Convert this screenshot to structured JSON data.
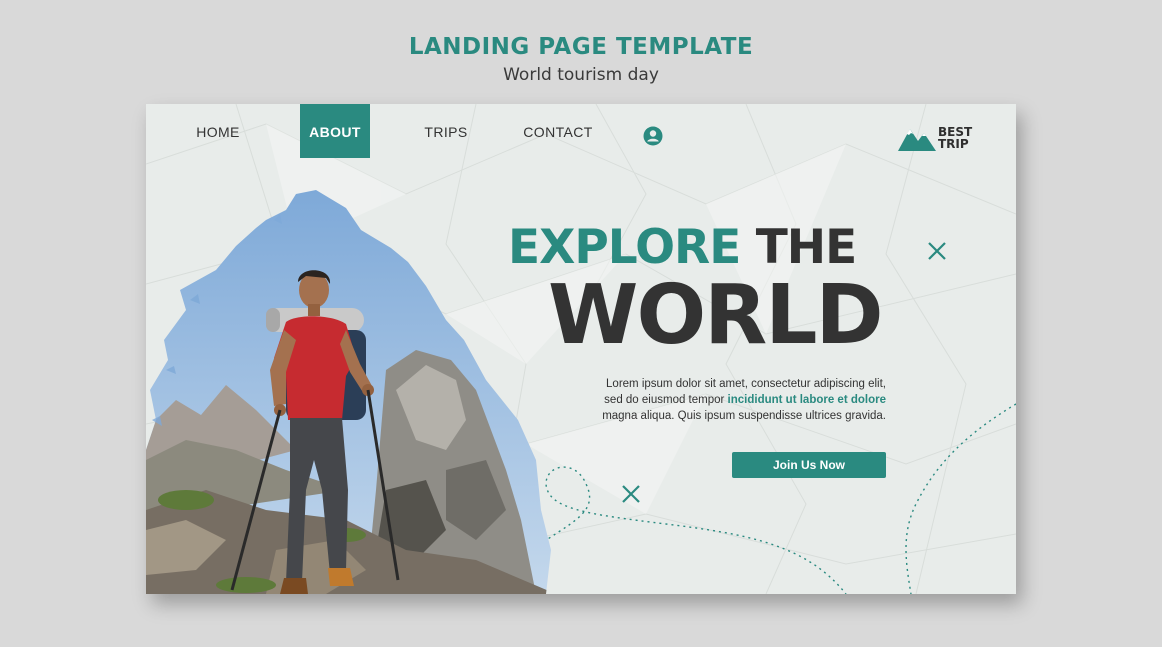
{
  "header": {
    "title": "LANDING PAGE TEMPLATE",
    "subtitle": "World tourism day"
  },
  "nav": {
    "items": [
      {
        "label": "HOME",
        "active": false
      },
      {
        "label": "ABOUT",
        "active": true
      },
      {
        "label": "TRIPS",
        "active": false
      },
      {
        "label": "CONTACT",
        "active": false
      }
    ]
  },
  "logo": {
    "line1": "BEST",
    "line2": "TRIP"
  },
  "hero": {
    "headline_teal": "EXPLORE",
    "headline_dark": "THE",
    "headline_big": "WORLD",
    "body_line1": "Lorem ipsum dolor sit amet, consectetur adipiscing elit,",
    "body_line2_plain": "sed do eiusmod tempor ",
    "body_line2_highlight": "incididunt ut labore et dolore",
    "body_line3": "magna aliqua. Quis ipsum suspendisse ultrices gravida.",
    "cta_label": "Join Us Now"
  },
  "colors": {
    "accent": "#2a8a80",
    "text_dark": "#333333",
    "background": "#d9d9d9",
    "card": "#e9ecea"
  },
  "icons": [
    "user-icon",
    "mountain-logo-icon",
    "cross-decoration-icon"
  ]
}
